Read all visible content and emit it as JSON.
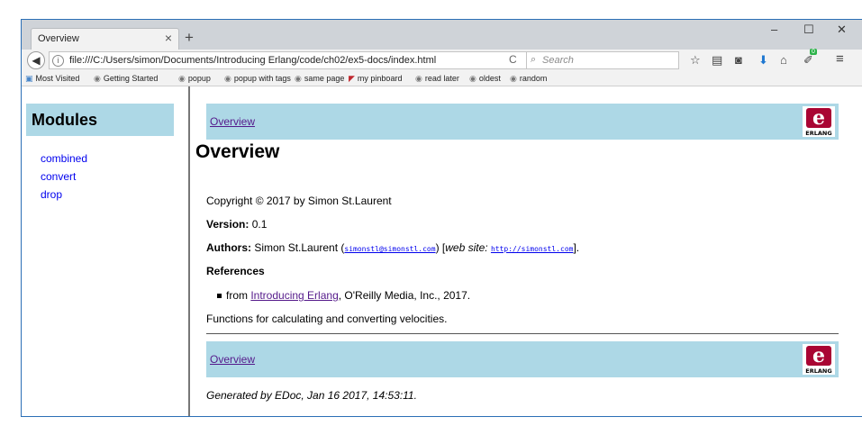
{
  "browser": {
    "tab_title": "Overview",
    "tab_close": "×",
    "new_tab": "+",
    "window_controls": {
      "minimize": "–",
      "maximize": "☐",
      "close": "✕"
    },
    "back_glyph": "◀",
    "info_glyph": "i",
    "url": "file:///C:/Users/simon/Documents/Introducing Erlang/code/ch02/ex5-docs/index.html",
    "reload_glyph": "C",
    "search_icon": "⌕",
    "search_placeholder": "Search",
    "toolbar_icons": [
      "star-icon",
      "reading-list-icon",
      "pocket-icon",
      "download-icon",
      "home-icon",
      "extension-icon",
      "menu-icon"
    ],
    "toolbar_glyphs": {
      "star": "☆",
      "reading": "▤",
      "pocket": "◙",
      "download": "⬇",
      "home": "⌂",
      "ext": "✐",
      "menu": "≡"
    },
    "extension_badge": "0",
    "bookmarks": [
      {
        "label": "Most Visited",
        "icon": "bookmark-icon"
      },
      {
        "label": "Getting Started",
        "icon": "globe-icon"
      },
      {
        "label": "popup",
        "icon": "globe-icon"
      },
      {
        "label": "popup with tags",
        "icon": "globe-icon"
      },
      {
        "label": "same page",
        "icon": "globe-icon"
      },
      {
        "label": "my pinboard",
        "icon": "pinboard-icon"
      },
      {
        "label": "read later",
        "icon": "globe-icon"
      },
      {
        "label": "oldest",
        "icon": "globe-icon"
      },
      {
        "label": "random",
        "icon": "globe-icon"
      }
    ]
  },
  "sidebar": {
    "heading": "Modules",
    "modules": [
      "combined",
      "convert",
      "drop"
    ]
  },
  "page": {
    "nav_link": "Overview",
    "title": "Overview",
    "copyright": "Copyright © 2017 by Simon St.Laurent",
    "version_label": "Version:",
    "version_value": "0.1",
    "authors_label": "Authors:",
    "author_name": "Simon St.Laurent (",
    "author_email": "simonstl@simonstl.com",
    "author_mid": ") [",
    "website_label": "web site:",
    "website_url": "http://simonstl.com",
    "author_end": "].",
    "references_heading": "References",
    "reference_prefix": "from",
    "reference_link": "Introducing Erlang",
    "reference_suffix": ", O'Reilly Media, Inc., 2017.",
    "description": "Functions for calculating and converting velocities.",
    "footer_nav_link": "Overview",
    "generated": "Generated by EDoc, Jan 16 2017, 14:53:11.",
    "logo_text": "ERLANG",
    "logo_letter": "e"
  },
  "colors": {
    "nav_bg": "#add8e6",
    "link": "#0000ee",
    "visited": "#551a8b",
    "erlang_red": "#a90533"
  }
}
